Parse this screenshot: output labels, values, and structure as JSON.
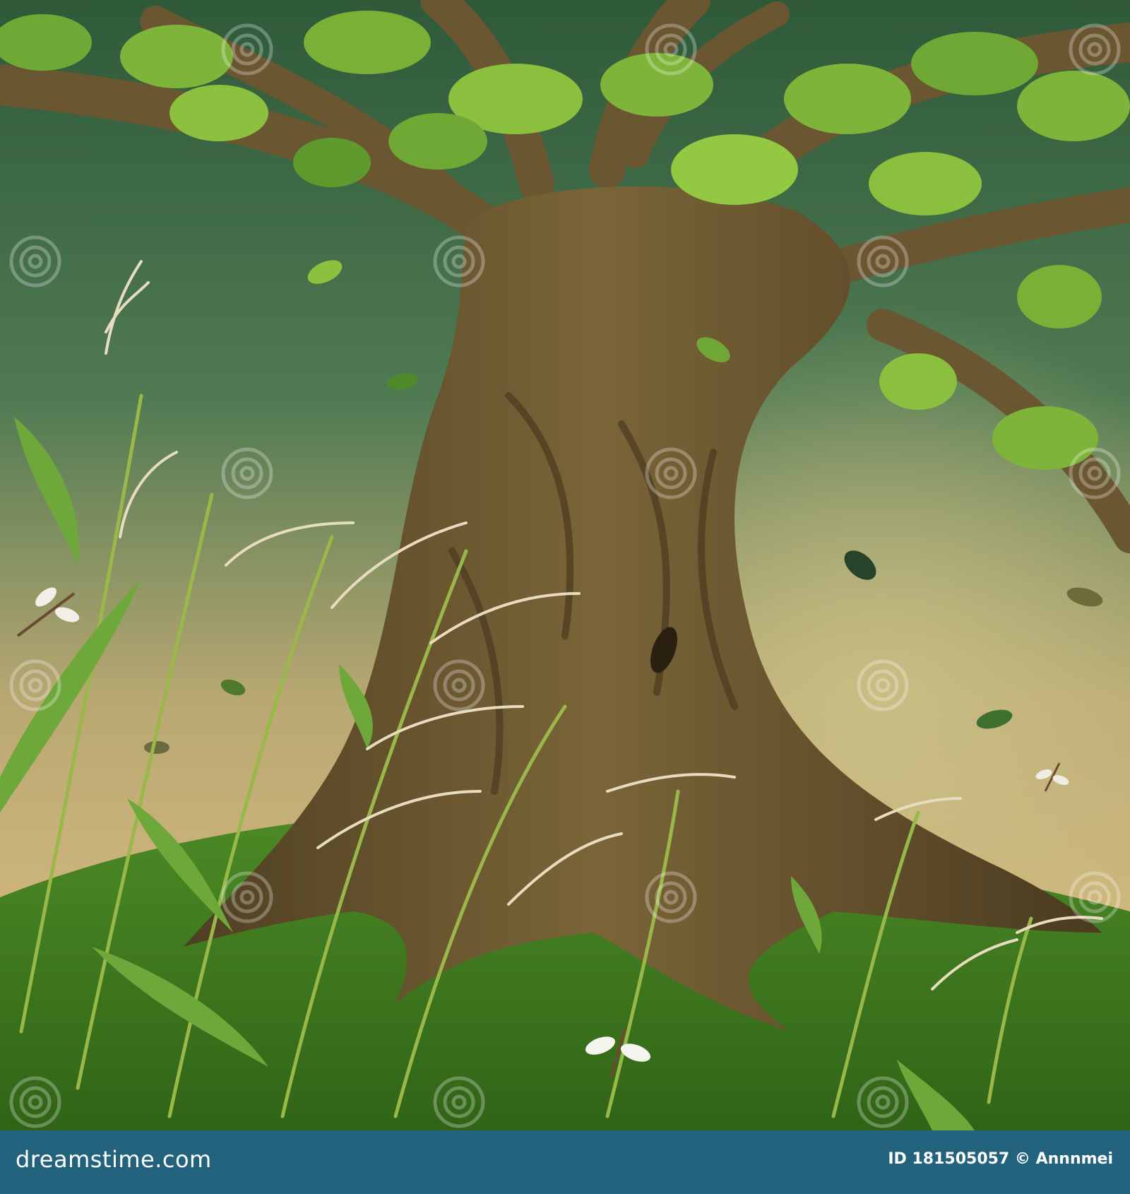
{
  "footer": {
    "site": "dreamstime.com",
    "id_label": "ID",
    "id_value": "181505057",
    "copyright": "©",
    "author": "Annnmei"
  },
  "watermark": {
    "text": "dreamstime"
  },
  "colors": {
    "footer_bg": "#22627c",
    "sky_top": "#3c6a44",
    "sky_bottom": "#cdb57c",
    "trunk": "#6a5630",
    "grass": "#3f7a1f",
    "leaf": "#7fb43a"
  }
}
